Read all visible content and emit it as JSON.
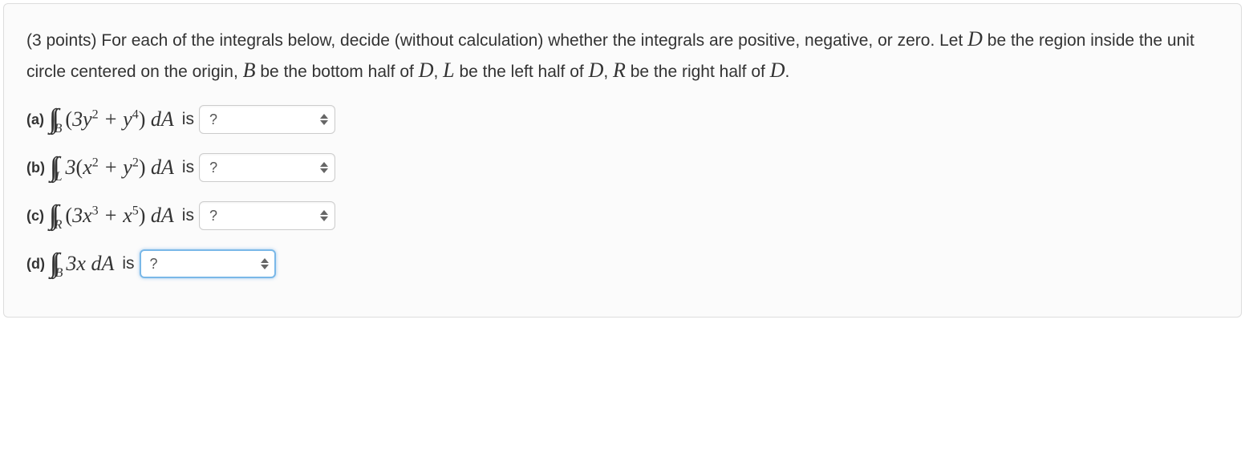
{
  "question": {
    "points_prefix": "(3 points)",
    "intro_text_1": " For each of the integrals below, decide (without calculation) whether the integrals are positive, negative, or zero. Let ",
    "var_D": "D",
    "intro_text_2": " be the region inside the unit circle centered on the origin, ",
    "var_B": "B",
    "intro_text_3": " be the bottom half of ",
    "var_D2": "D",
    "intro_text_4": ", ",
    "var_L": "L",
    "intro_text_5": " be the left half of ",
    "var_D3": "D",
    "intro_text_6": ", ",
    "var_R": "R",
    "intro_text_7": " be the right half of ",
    "var_D4": "D",
    "intro_text_8": "."
  },
  "parts": {
    "a": {
      "label": "(a)",
      "sub": "B",
      "coef1": "3",
      "v1": "y",
      "e1": "2",
      "plus": " + ",
      "v2": "y",
      "e2": "4",
      "dA": " dA",
      "is": "is",
      "select_value": "?"
    },
    "b": {
      "label": "(b)",
      "sub": "L",
      "coef1": "3",
      "v1": "x",
      "e1": "2",
      "plus": " + ",
      "v2": "y",
      "e2": "2",
      "dA": " dA",
      "is": "is",
      "select_value": "?"
    },
    "c": {
      "label": "(c)",
      "sub": "R",
      "coef1": "3",
      "v1": "x",
      "e1": "3",
      "plus": " + ",
      "v2": "x",
      "e2": "5",
      "dA": " dA",
      "is": "is",
      "select_value": "?"
    },
    "d": {
      "label": "(d)",
      "sub": "B",
      "coef1": "3",
      "v1": "x",
      "dA": " dA",
      "is": "is",
      "select_value": "?"
    }
  }
}
